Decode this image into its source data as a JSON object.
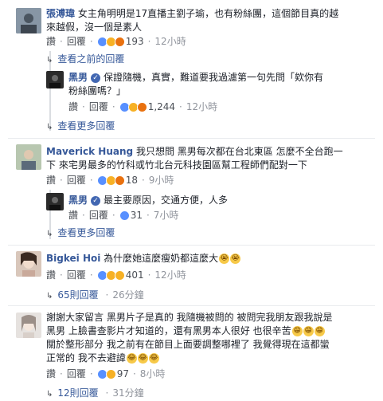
{
  "common": {
    "like": "讚",
    "reply": "回覆",
    "dot": "·"
  },
  "c1": {
    "name": "張溥瑋",
    "line1": "女主角明明是17直播主劉子瑜，也有粉絲團，這個節目真的越",
    "line2": "來越假，沒一個是素人",
    "count": "193",
    "time": "12小時"
  },
  "view_previous": "查看之前的回覆",
  "r1": {
    "name": "黑男",
    "line1": "保證隨機，真實，難道要我過濾第一句先問「欸你有",
    "line2": "粉絲團嗎？」",
    "count": "1,244",
    "time": "12小時"
  },
  "view_more_1": "查看更多回覆",
  "c2": {
    "name": "Maverick Huang",
    "line1": "我只想問 黑男每次都在台北東區 怎麼不全台跑一",
    "line2": "下 來宅男最多的竹科或竹北台元科技園區幫工程師們配對一下",
    "count": "18",
    "time": "9小時"
  },
  "r2": {
    "name": "黑男",
    "text": "最主要原因，交通方便，人多",
    "count": "31",
    "time": "7小時"
  },
  "view_more_2": "查看更多回覆",
  "c3": {
    "name": "Bigkei Hoi",
    "text": "為什麼她這麼瘦奶都這麼大",
    "count": "401",
    "time": "12小時",
    "replies": "65則回覆",
    "replies_time": "26分鐘"
  },
  "c4": {
    "line1": "謝謝大家留言 黑男片子是真的 我隨機被問的 被問完我朋友跟我說是",
    "line2": "黑男 上臉書查影片才知道的，還有黑男本人很好 也很辛苦",
    "line3": "關於整形部分 我之前有在節目上面要調整哪裡了 我覺得現在這都蠻",
    "line4": "正常的 我不去避諱",
    "count": "97",
    "time": "8小時",
    "replies": "12則回覆",
    "replies_time": "31分鐘"
  },
  "colors": {
    "link": "#365899",
    "meta": "#90949c",
    "like": "#5890ff"
  }
}
